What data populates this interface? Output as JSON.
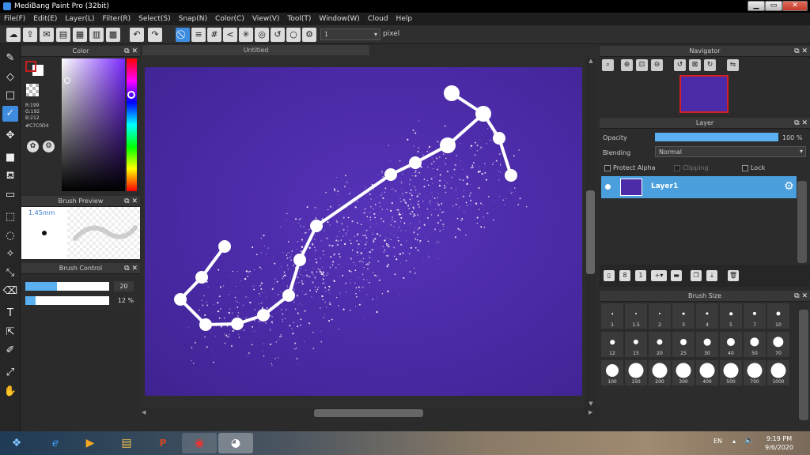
{
  "window": {
    "title": "MediBang Paint Pro (32bit)",
    "min": "▁",
    "max": "▭",
    "close": "✕"
  },
  "menu": [
    "File(F)",
    "Edit(E)",
    "Layer(L)",
    "Filter(R)",
    "Select(S)",
    "Snap(N)",
    "Color(C)",
    "View(V)",
    "Tool(T)",
    "Window(W)",
    "Cloud",
    "Help"
  ],
  "toolbar": {
    "brush_size_value": "1",
    "brush_size_unit": "pixel"
  },
  "color_panel": {
    "title": "Color",
    "r": "R:199",
    "g": "G:192",
    "b": "B:212",
    "hex": "#C7C0D4",
    "primary_color": "#c42020",
    "secondary_color": "#ffffff"
  },
  "brush_preview": {
    "title": "Brush Preview",
    "size_label": "1.45mm"
  },
  "brush_control": {
    "title": "Brush Control",
    "size_value": "20",
    "size_fraction": 0.38,
    "opacity_value": "12 %",
    "opacity_fraction": 0.12
  },
  "document": {
    "tab_title": "Untitled"
  },
  "navigator": {
    "title": "Navigator"
  },
  "layer_panel": {
    "title": "Layer",
    "opacity_label": "Opacity",
    "opacity_value": "100 %",
    "opacity_fraction": 1.0,
    "blending_label": "Blending",
    "blending_value": "Normal",
    "protect_alpha": "Protect Alpha",
    "clipping": "Clipping",
    "lock": "Lock",
    "layers": [
      {
        "name": "Layer1"
      }
    ]
  },
  "brush_size_panel": {
    "title": "Brush Size",
    "sizes": [
      "1",
      "1.5",
      "2",
      "3",
      "4",
      "5",
      "7",
      "10",
      "12",
      "15",
      "20",
      "25",
      "30",
      "40",
      "50",
      "70",
      "100",
      "150",
      "200",
      "300",
      "400",
      "500",
      "700",
      "1000"
    ]
  },
  "taskbar": {
    "language": "EN",
    "time": "9:19 PM",
    "date": "9/6/2020"
  }
}
